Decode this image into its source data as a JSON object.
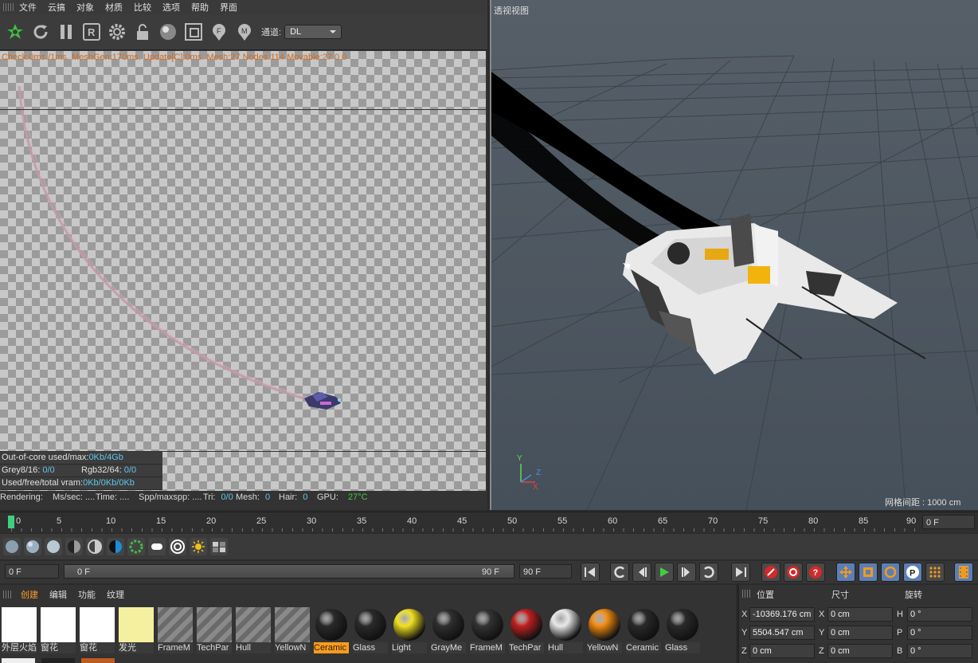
{
  "menubar": {
    "items": [
      "文件",
      "云搞",
      "对象",
      "材质",
      "比较",
      "选项",
      "帮助",
      "界面"
    ]
  },
  "toolbar": {
    "icons": [
      "render-icon",
      "refresh-icon",
      "pause-icon",
      "region-icon",
      "settings-icon",
      "lock-icon",
      "material-ball-icon",
      "clipping-icon",
      "focus-pick-icon",
      "material-pick-icon"
    ],
    "channel_label": "通道:",
    "channel_value": "DL"
  },
  "render": {
    "status_line": "Check:0ms./1ms. MeshGen:170ms. Update[C]:0ms. Mesh:27 Nodes:114 Movable:27  0 0",
    "ooc_label": "Out-of-core used/max:",
    "ooc_value": "0Kb/4Gb",
    "grey_label": "Grey8/16:",
    "grey_value": "0/0",
    "rgb_label": "Rgb32/64:",
    "rgb_value": "0/0",
    "vram_label": "Used/free/total vram:",
    "vram_value": "0Kb/0Kb/0Kb"
  },
  "renderbar": {
    "rendering": "Rendering:",
    "mss": "Ms/sec: ....",
    "time": "Time: ....",
    "spp": "Spp/maxspp: ....",
    "tri_label": "Tri:",
    "tri_value": "0/0",
    "mesh_label": "Mesh:",
    "mesh_value": "0",
    "hair_label": "Hair:",
    "hair_value": "0",
    "gpu_label": "GPU:",
    "gpu_value": "27°C"
  },
  "viewport": {
    "title": "透视视图",
    "grid_label": "网格间距 : 1000 cm",
    "axis_y": "Y",
    "axis_z": "Z",
    "axis_x": "X"
  },
  "timeline": {
    "ticks": [
      "0",
      "5",
      "10",
      "15",
      "20",
      "25",
      "30",
      "35",
      "40",
      "45",
      "50",
      "55",
      "60",
      "65",
      "70",
      "75",
      "80",
      "85",
      "90"
    ],
    "current": "0 F"
  },
  "transport": {
    "start": "0 F",
    "range_start": "0 F",
    "range_end": "90 F",
    "end": "90 F"
  },
  "materials": {
    "tabs": [
      "创建",
      "编辑",
      "功能",
      "纹理"
    ],
    "swatches": [
      {
        "label": "外层火焰",
        "color": "#ffffff"
      },
      {
        "label": "窗花",
        "color": "#ffffff"
      },
      {
        "label": "窗花",
        "color": "#ffffff"
      },
      {
        "label": "发光",
        "color": "#f5f0a0"
      },
      {
        "label": "FrameM",
        "color": "#777777"
      },
      {
        "label": "TechPar",
        "color": "#777777"
      },
      {
        "label": "Hull",
        "color": "#777777"
      },
      {
        "label": "YellowN",
        "color": "#777777"
      },
      {
        "label": "Ceramic",
        "color": "#2a2a2a"
      },
      {
        "label": "Glass",
        "color": "#2a2a2a"
      },
      {
        "label": "Light",
        "color": "#f0e020"
      },
      {
        "label": "GrayMe",
        "color": "#2f2f2f"
      },
      {
        "label": "FrameM",
        "color": "#333333"
      },
      {
        "label": "TechPar",
        "color": "#c02020"
      },
      {
        "label": "Hull",
        "color": "#e8e8e8"
      },
      {
        "label": "YellowN",
        "color": "#f08a10"
      },
      {
        "label": "Ceramic",
        "color": "#2a2a2a"
      },
      {
        "label": "Glass",
        "color": "#2a2a2a"
      }
    ]
  },
  "coords": {
    "headers": [
      "位置",
      "尺寸",
      "旋转"
    ],
    "rows": [
      {
        "a": "X",
        "v1": "-10369.176 cm",
        "b": "X",
        "v2": "0 cm",
        "c": "H",
        "v3": "0 °"
      },
      {
        "a": "Y",
        "v1": "5504.547 cm",
        "b": "Y",
        "v2": "0 cm",
        "c": "P",
        "v3": "0 °"
      },
      {
        "a": "Z",
        "v1": "0 cm",
        "b": "Z",
        "v2": "0 cm",
        "c": "B",
        "v3": "0 °"
      }
    ]
  }
}
